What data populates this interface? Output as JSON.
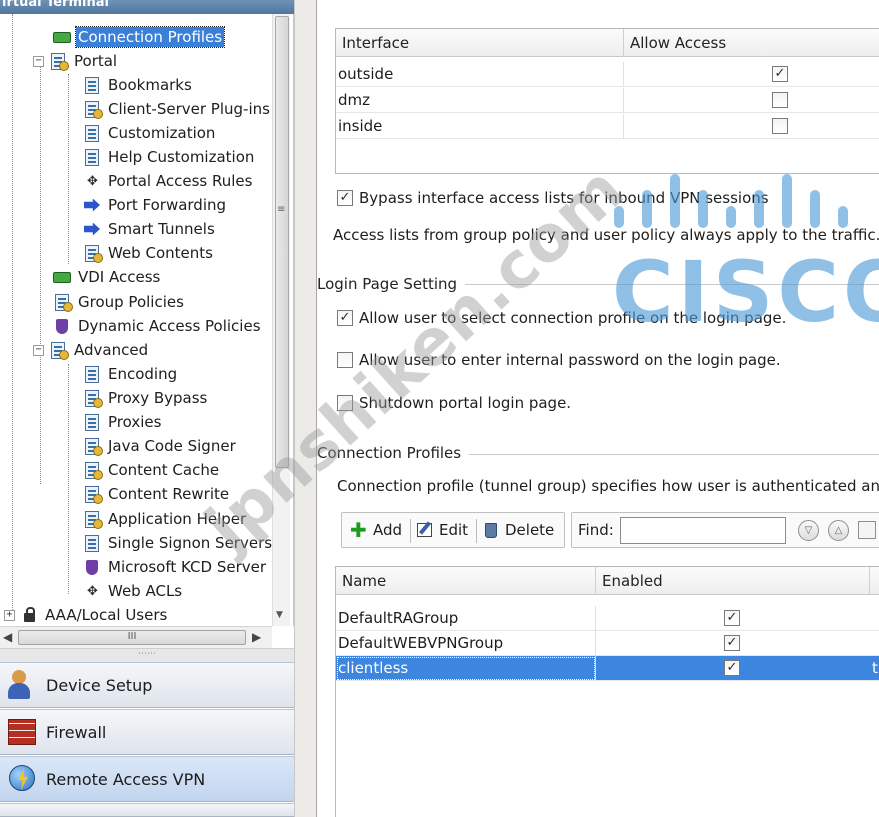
{
  "window": {
    "title": "irtual Terminal"
  },
  "tree": {
    "items": [
      {
        "label": "Connection Profiles",
        "selected": true,
        "icon": "connection-profile-icon"
      },
      {
        "label": "Portal",
        "icon": "portal-icon",
        "expander": "−"
      },
      {
        "label": "Bookmarks",
        "icon": "bookmarks-icon"
      },
      {
        "label": "Client-Server Plug-ins",
        "icon": "plugins-icon"
      },
      {
        "label": "Customization",
        "icon": "customization-icon"
      },
      {
        "label": "Help Customization",
        "icon": "help-customization-icon"
      },
      {
        "label": "Portal Access Rules",
        "icon": "access-rules-icon"
      },
      {
        "label": "Port Forwarding",
        "icon": "port-forwarding-icon"
      },
      {
        "label": "Smart Tunnels",
        "icon": "smart-tunnels-icon"
      },
      {
        "label": "Web Contents",
        "icon": "web-contents-icon"
      },
      {
        "label": "VDI Access",
        "icon": "vdi-access-icon"
      },
      {
        "label": "Group Policies",
        "icon": "group-policies-icon"
      },
      {
        "label": "Dynamic Access Policies",
        "icon": "dynamic-access-policies-icon"
      },
      {
        "label": "Advanced",
        "icon": "advanced-icon",
        "expander": "−"
      },
      {
        "label": "Encoding",
        "icon": "encoding-icon"
      },
      {
        "label": "Proxy Bypass",
        "icon": "proxy-bypass-icon"
      },
      {
        "label": "Proxies",
        "icon": "proxies-icon"
      },
      {
        "label": "Java Code Signer",
        "icon": "java-code-signer-icon"
      },
      {
        "label": "Content Cache",
        "icon": "content-cache-icon"
      },
      {
        "label": "Content Rewrite",
        "icon": "content-rewrite-icon"
      },
      {
        "label": "Application Helper",
        "icon": "application-helper-icon"
      },
      {
        "label": "Single Signon Servers",
        "icon": "sso-servers-icon"
      },
      {
        "label": "Microsoft KCD Server",
        "icon": "kcd-server-icon"
      },
      {
        "label": "Web ACLs",
        "icon": "web-acls-icon"
      },
      {
        "label": "AAA/Local Users",
        "icon": "lock-icon",
        "expander": "+"
      }
    ],
    "hscroll_grip": "III"
  },
  "nav": {
    "device_setup": "Device Setup",
    "firewall": "Firewall",
    "remote_access_vpn": "Remote Access VPN"
  },
  "interfaces": {
    "columns": [
      "Interface",
      "Allow Access"
    ],
    "rows": [
      {
        "name": "outside",
        "allow": true
      },
      {
        "name": "dmz",
        "allow": false
      },
      {
        "name": "inside",
        "allow": false
      }
    ]
  },
  "bypass": {
    "label": "Bypass interface access lists for inbound VPN sessions",
    "checked": true,
    "note": "Access lists from group policy and user policy always apply to the traffic."
  },
  "login_page": {
    "title": "Login Page Setting",
    "options": [
      {
        "label": "Allow user to select connection profile on the login page.",
        "checked": true
      },
      {
        "label": "Allow user to enter internal password on the login page.",
        "checked": false
      },
      {
        "label": "Shutdown portal login page.",
        "checked": false
      }
    ]
  },
  "connection_profiles": {
    "title": "Connection Profiles",
    "description": "Connection profile (tunnel group) specifies how user is authenticated and o",
    "toolbar": {
      "add": "Add",
      "edit": "Edit",
      "delete": "Delete",
      "find_label": "Find:",
      "find_value": ""
    },
    "columns": [
      "Name",
      "Enabled"
    ],
    "rows": [
      {
        "name": "DefaultRAGroup",
        "enabled": true,
        "selected": false,
        "extra": ""
      },
      {
        "name": "DefaultWEBVPNGroup",
        "enabled": true,
        "selected": false,
        "extra": ""
      },
      {
        "name": "clientless",
        "enabled": true,
        "selected": true,
        "extra": "t"
      }
    ]
  },
  "watermarks": {
    "cisco": "CISCO",
    "site": "jpnshiken.com"
  },
  "colors": {
    "selection": "#3d86df",
    "cisco_watermark": "#4e9bd8"
  }
}
